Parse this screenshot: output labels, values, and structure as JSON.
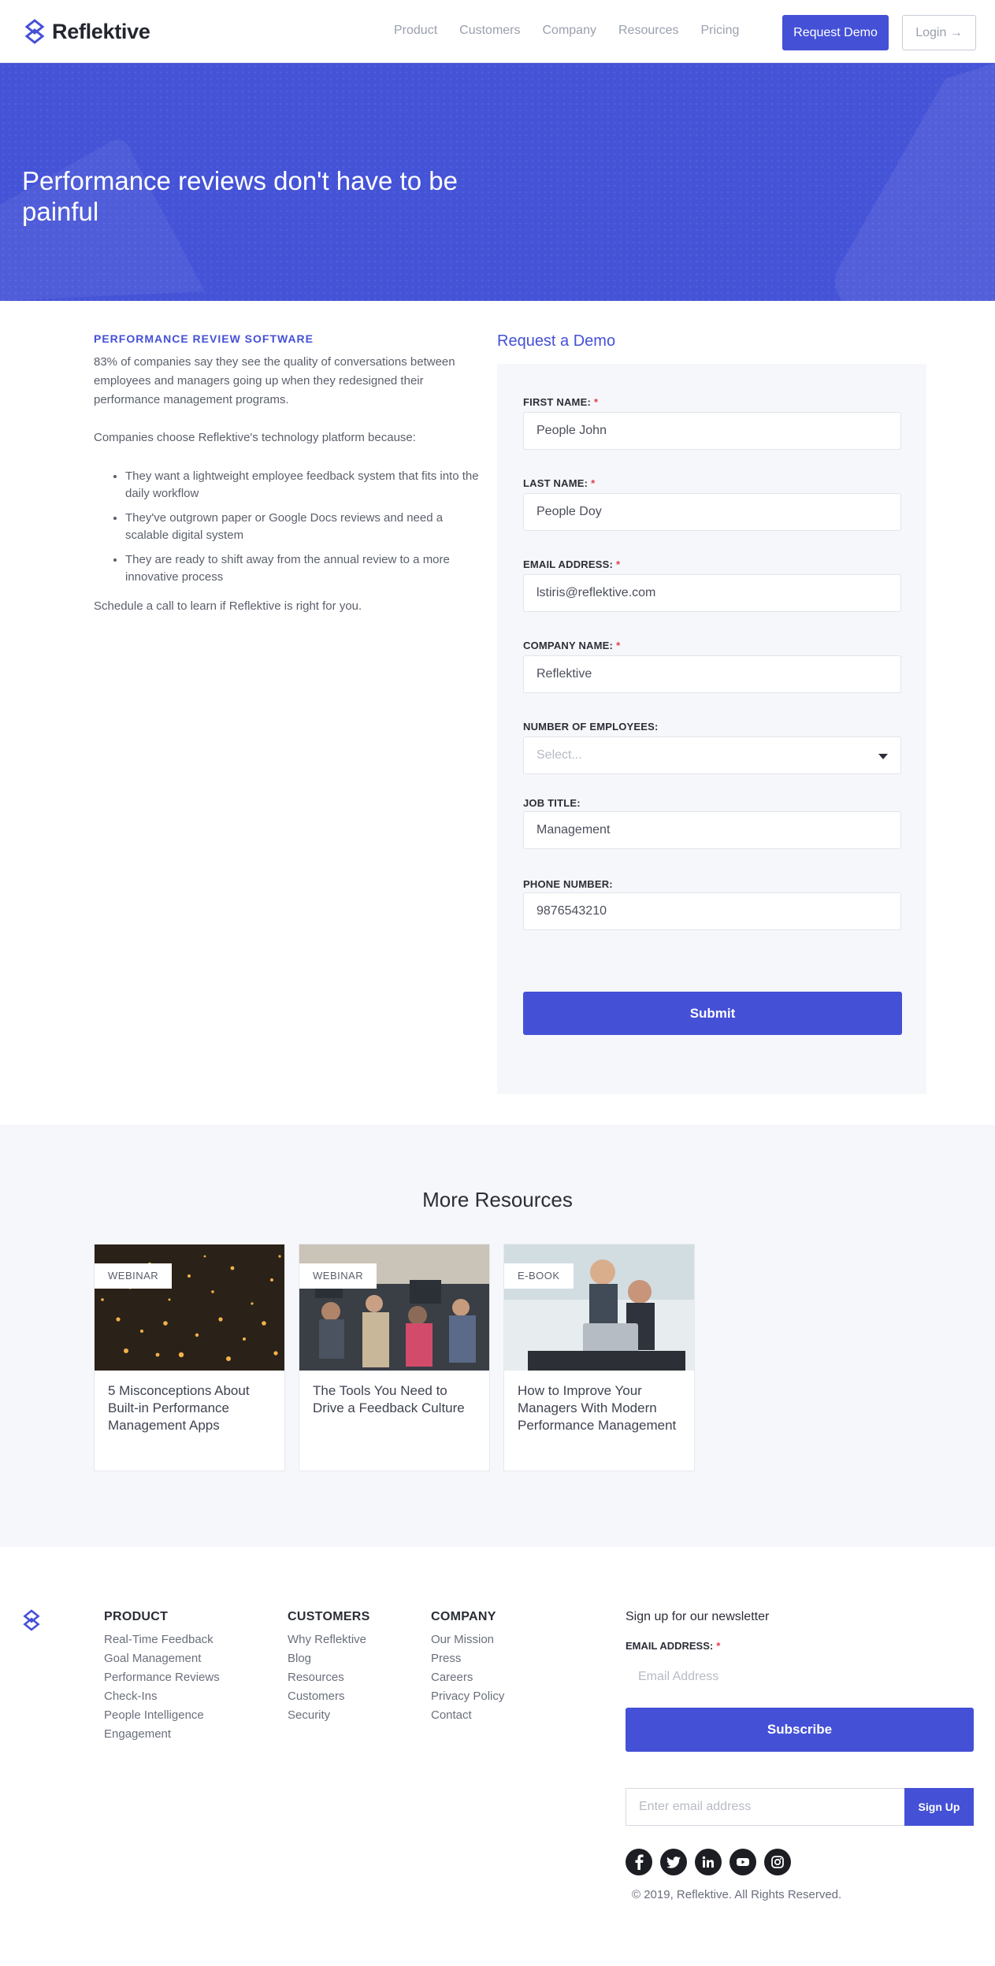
{
  "brand": {
    "name": "Reflektive",
    "accent": "#4450d6",
    "hero_bg": "#4553d7"
  },
  "nav": {
    "links": [
      "Product",
      "Customers",
      "Company",
      "Resources",
      "Pricing"
    ],
    "request_demo": "Request Demo",
    "login": "Login →"
  },
  "hero": {
    "title": "Performance reviews don't have to be painful"
  },
  "intro": {
    "eyebrow": "PERFORMANCE REVIEW SOFTWARE",
    "p1": "83% of companies say they see the quality of conversations between employees and managers going up when they redesigned their performance management programs.",
    "p2": "Companies choose Reflektive's technology platform because:",
    "bullets": [
      "They want a lightweight employee feedback system that fits into the daily workflow",
      "They've outgrown paper or Google Docs reviews and need a scalable digital system",
      "They are ready to shift away from the annual review to a more innovative process"
    ],
    "p3": "Schedule a call to learn if Reflektive is right for you."
  },
  "form": {
    "title": "Request a Demo",
    "fields": [
      {
        "label": "FIRST NAME:",
        "required": "*",
        "value": "People John"
      },
      {
        "label": "LAST NAME:",
        "required": "*",
        "value": "People Doy"
      },
      {
        "label": "EMAIL ADDRESS:",
        "required": "*",
        "value": "lstiris@reflektive.com"
      },
      {
        "label": "COMPANY NAME:",
        "required": "*",
        "value": "Reflektive"
      },
      {
        "label": "NUMBER OF EMPLOYEES:",
        "required": "",
        "value": "Select..."
      },
      {
        "label": "JOB TITLE:",
        "required": "",
        "value": "Management"
      },
      {
        "label": "PHONE NUMBER:",
        "required": "",
        "value": "9876543210"
      }
    ],
    "submit": "Submit"
  },
  "resources": {
    "title": "More Resources",
    "cards": [
      {
        "tag": "WEBINAR",
        "title": "5 Misconceptions About Built-in Performance Management Apps"
      },
      {
        "tag": "WEBINAR",
        "title": "The Tools You Need to Drive a Feedback Culture"
      },
      {
        "tag": "E-BOOK",
        "title": "How to Improve Your Managers With Modern Performance Management"
      }
    ]
  },
  "footer": {
    "columns": [
      {
        "head": "PRODUCT",
        "links": [
          "Real-Time Feedback",
          "Goal Management",
          "Performance Reviews",
          "Check-Ins",
          "People Intelligence",
          "Engagement"
        ]
      },
      {
        "head": "CUSTOMERS",
        "links": [
          "Why Reflektive",
          "Blog",
          "Resources",
          "Customers",
          "Security"
        ]
      },
      {
        "head": "COMPANY",
        "links": [
          "Our Mission",
          "Press",
          "Careers",
          "Privacy Policy",
          "Contact"
        ]
      }
    ],
    "newsletter_title": "Sign up for our newsletter",
    "email_label": "EMAIL ADDRESS:",
    "email_required": "*",
    "email_placeholder": "Email Address",
    "subscribe": "Subscribe",
    "signup_placeholder": "Enter email address",
    "signup": "Sign Up",
    "socials": [
      "facebook-icon",
      "twitter-icon",
      "linkedin-icon",
      "youtube-icon",
      "instagram-icon"
    ],
    "copyright": "© 2019, Reflektive. All Rights Reserved."
  }
}
